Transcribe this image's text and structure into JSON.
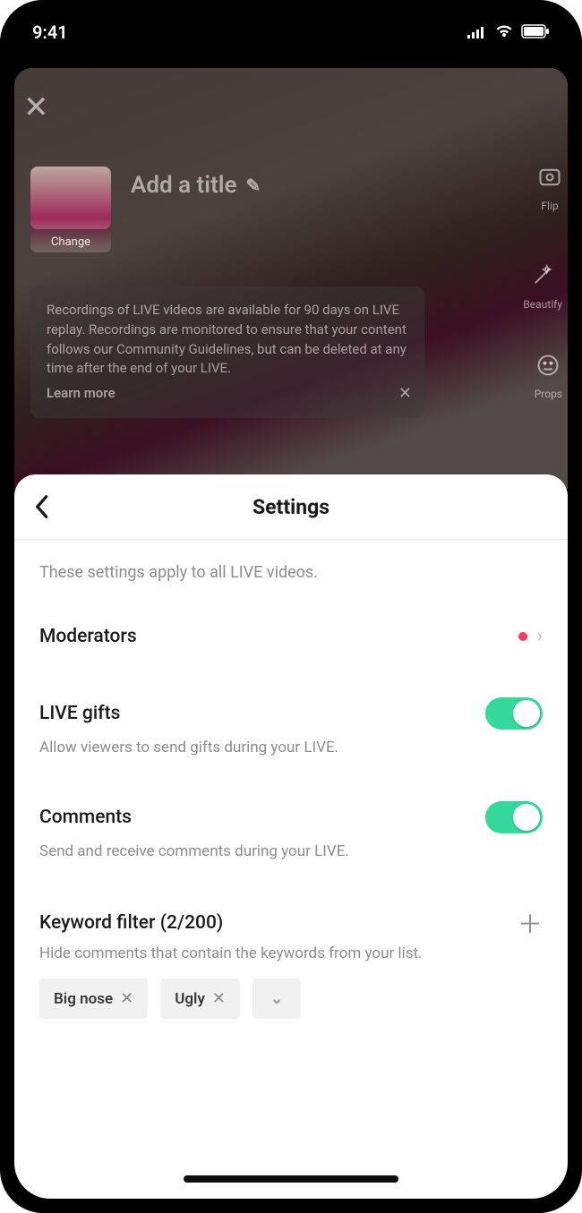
{
  "status": {
    "time": "9:41"
  },
  "bg": {
    "close": "✕",
    "change_label": "Change",
    "title_placeholder": "Add a title",
    "side": {
      "flip": "Flip",
      "beautify": "Beautify",
      "props": "Props"
    },
    "notice_text": "Recordings of LIVE videos are available for 90 days on LIVE replay. Recordings are monitored to ensure that your content follows our Community Guidelines, but can be deleted at any time after the end of your LIVE.",
    "notice_learn": "Learn more"
  },
  "sheet": {
    "title": "Settings",
    "description": "These settings apply to all LIVE videos.",
    "moderators_label": "Moderators",
    "gifts_label": "LIVE gifts",
    "gifts_desc": "Allow viewers to send gifts during your LIVE.",
    "comments_label": "Comments",
    "comments_desc": "Send and receive comments during your LIVE.",
    "filter_label": "Keyword filter (2/200)",
    "filter_desc": "Hide comments that contain the keywords from your list.",
    "chips": {
      "0": "Big nose",
      "1": "Ugly"
    }
  }
}
